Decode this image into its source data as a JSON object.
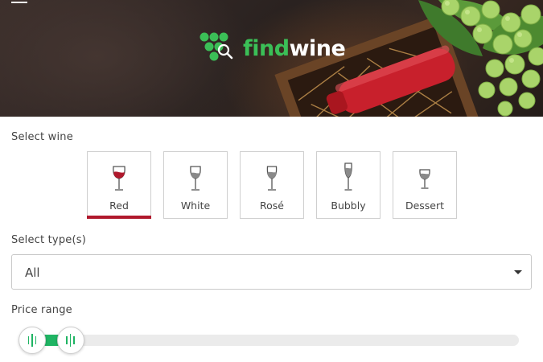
{
  "header": {
    "logo": {
      "find": "find",
      "wine": "wine"
    },
    "menu_icon": "hamburger-menu-icon"
  },
  "wine_section": {
    "label": "Select wine",
    "selected": "Red",
    "items": [
      {
        "label": "Red",
        "icon": "red-wine-glass-icon"
      },
      {
        "label": "White",
        "icon": "white-wine-glass-icon"
      },
      {
        "label": "Rosé",
        "icon": "rose-wine-glass-icon"
      },
      {
        "label": "Bubbly",
        "icon": "champagne-flute-icon"
      },
      {
        "label": "Dessert",
        "icon": "dessert-wine-glass-icon"
      }
    ]
  },
  "type_section": {
    "label": "Select type(s)",
    "selected_value": "All"
  },
  "price_section": {
    "label": "Price range",
    "range_fraction": [
      0.0,
      0.08
    ]
  },
  "colors": {
    "brand_green": "#3bbf57",
    "slider_green": "#1fb463",
    "selected_red": "#b0182c",
    "red_wine": "#b0182c"
  }
}
